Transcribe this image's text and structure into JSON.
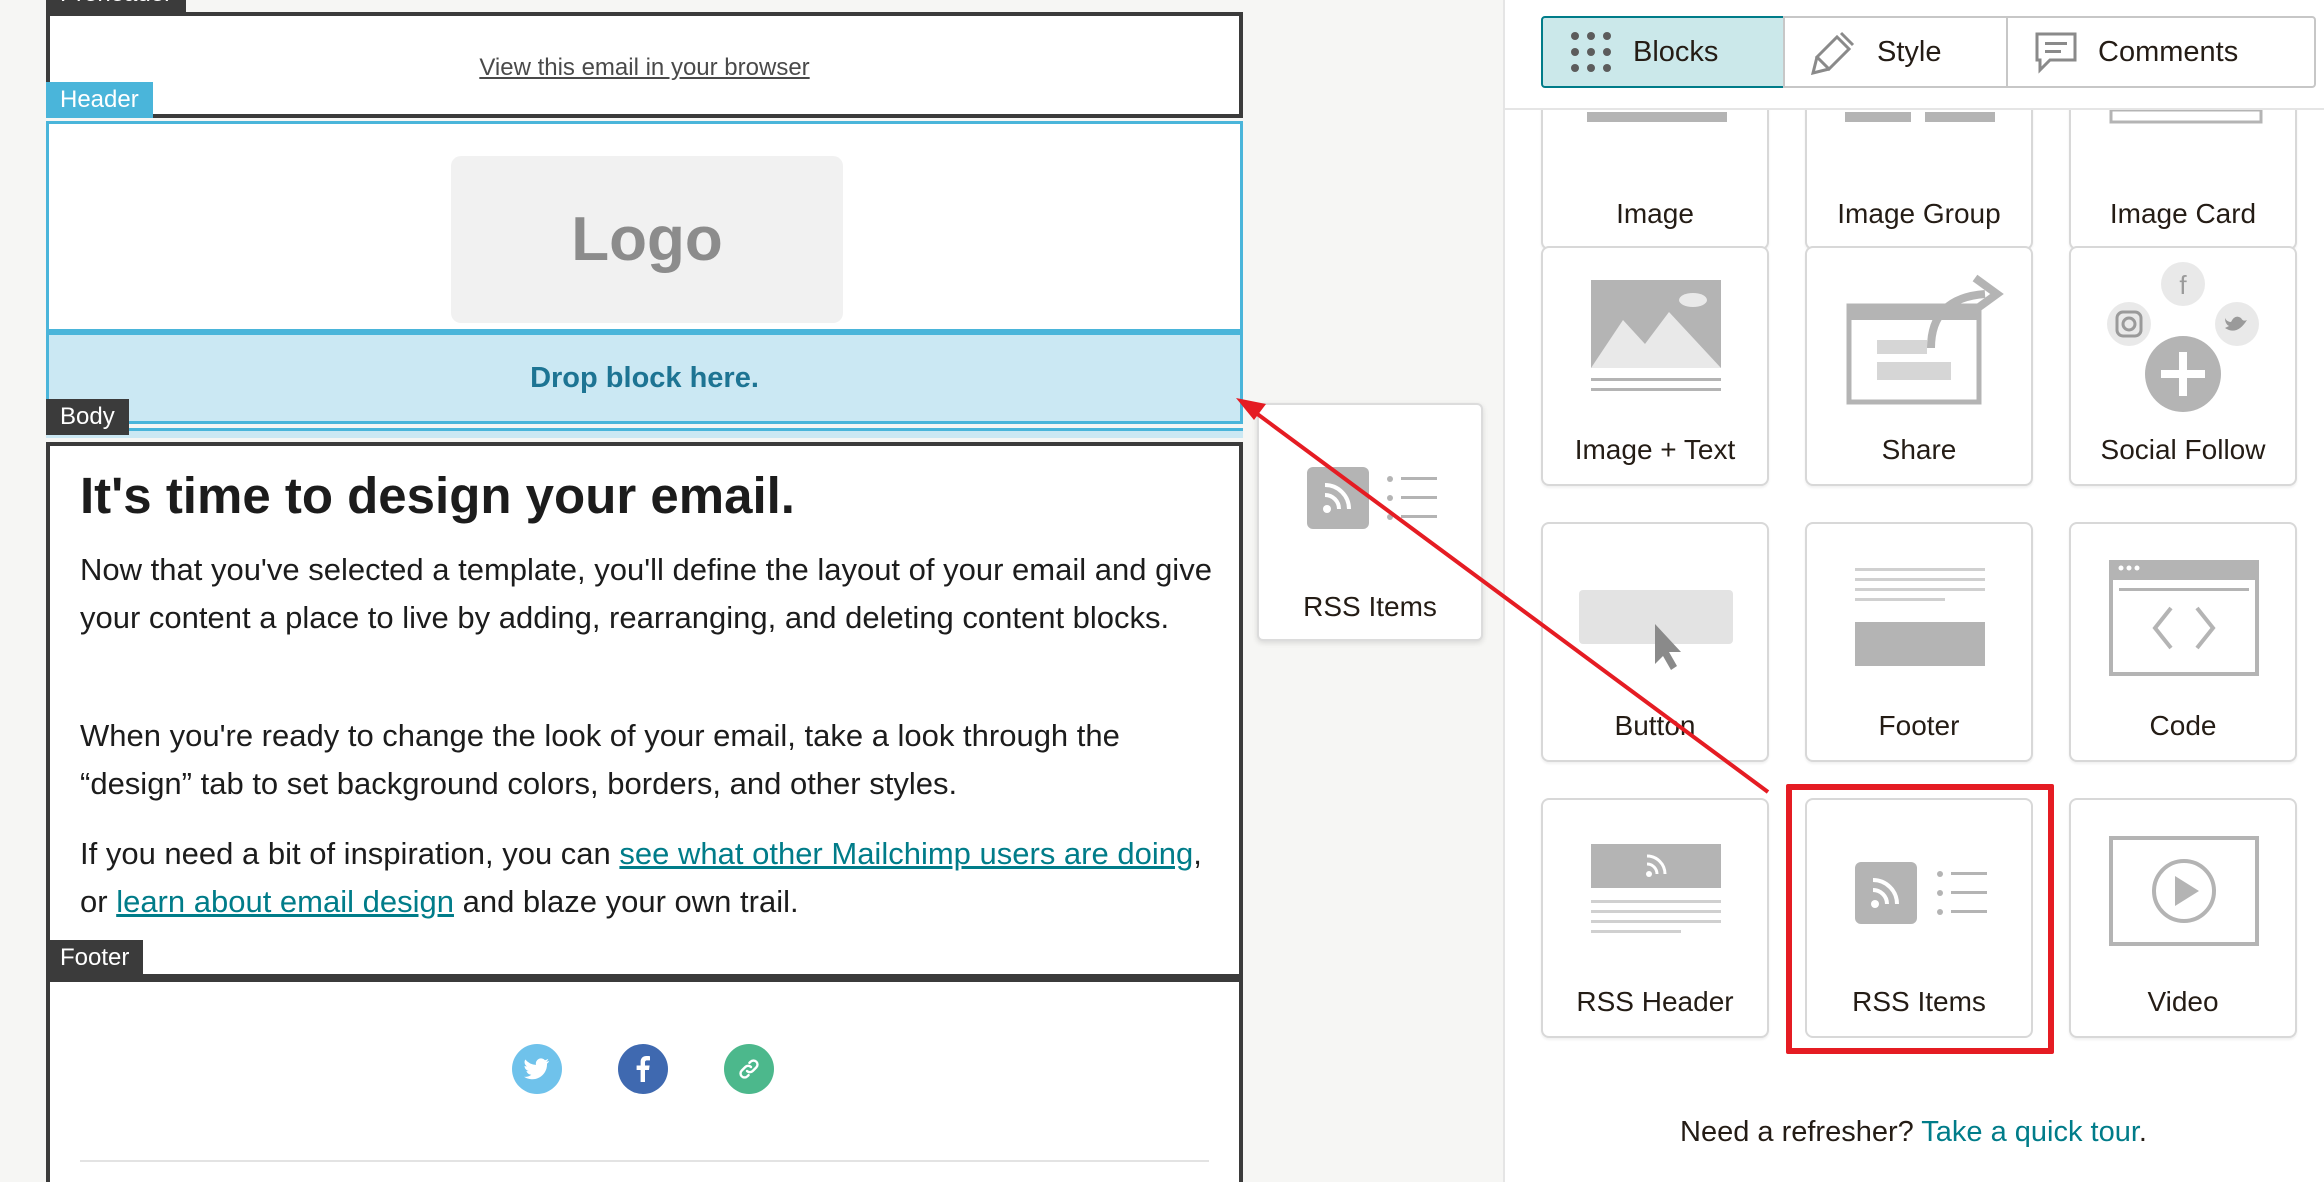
{
  "canvas": {
    "preheader": {
      "tag": "Preheader",
      "view_link": "View this email in your browser"
    },
    "header": {
      "tag": "Header",
      "logo_text": "Logo"
    },
    "drop_zone": "Drop block here.",
    "body": {
      "tag": "Body",
      "heading": "It's time to design your email.",
      "para1": "Now that you've selected a template, you'll define the layout of your email and give your content a place to live by adding, rearranging, and deleting content blocks.",
      "para2": "When you're ready to change the look of your email, take a look through the “design” tab to set background colors, borders, and other styles.",
      "para3_prefix": "If you need a bit of inspiration, you can ",
      "para3_link1": "see what other Mailchimp users are doing",
      "para3_mid": ", or ",
      "para3_link2": "learn about email design",
      "para3_suffix": " and blaze your own trail."
    },
    "footer": {
      "tag": "Footer",
      "social": [
        "twitter-icon",
        "facebook-icon",
        "link-icon"
      ]
    }
  },
  "drag_preview": {
    "label": "RSS Items"
  },
  "panel": {
    "tabs": [
      {
        "label": "Blocks",
        "icon": "grid-icon",
        "active": true
      },
      {
        "label": "Style",
        "icon": "paint-icon",
        "active": false
      },
      {
        "label": "Comments",
        "icon": "comment-icon",
        "active": false
      }
    ],
    "blocks": [
      {
        "label": "Image"
      },
      {
        "label": "Image Group"
      },
      {
        "label": "Image Card"
      },
      {
        "label": "Image + Text"
      },
      {
        "label": "Share"
      },
      {
        "label": "Social Follow"
      },
      {
        "label": "Button"
      },
      {
        "label": "Footer"
      },
      {
        "label": "Code"
      },
      {
        "label": "RSS Header"
      },
      {
        "label": "RSS Items"
      },
      {
        "label": "Video"
      }
    ],
    "refresher_text": "Need a refresher? ",
    "refresher_link": "Take a quick tour",
    "refresher_end": "."
  },
  "colors": {
    "accent": "#007c89",
    "header_blue": "#4ab5da",
    "drop_bg": "#cbe8f3",
    "highlight_red": "#e51c23"
  }
}
